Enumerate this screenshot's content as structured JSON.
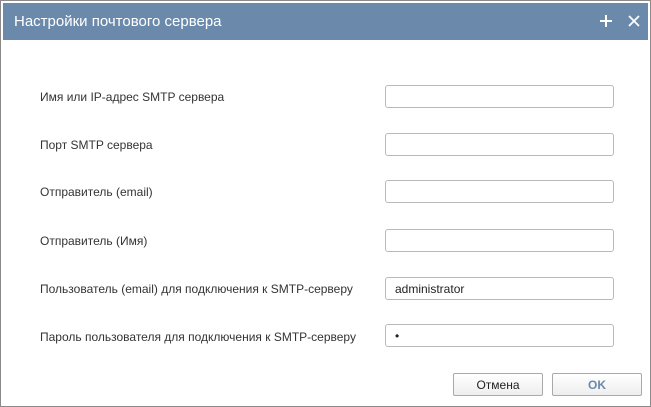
{
  "dialog": {
    "title": "Настройки почтового сервера"
  },
  "icons": {
    "maximize": "plus-icon",
    "close": "close-icon"
  },
  "fields": [
    {
      "label": "Имя или IP-адрес SMTP сервера",
      "value": ""
    },
    {
      "label": "Порт SMTP сервера",
      "value": ""
    },
    {
      "label": "Отправитель (email)",
      "value": ""
    },
    {
      "label": "Отправитель (Имя)",
      "value": ""
    },
    {
      "label": "Пользователь (email) для подключения к SMTP-серверу",
      "value": "administrator"
    },
    {
      "label": "Пароль пользователя для подключения к SMTP-серверу",
      "value": "•"
    }
  ],
  "buttons": {
    "cancel": "Отмена",
    "ok": "OK"
  },
  "colors": {
    "titlebar": "#6b8aab",
    "ok_text": "#6b8aab"
  }
}
